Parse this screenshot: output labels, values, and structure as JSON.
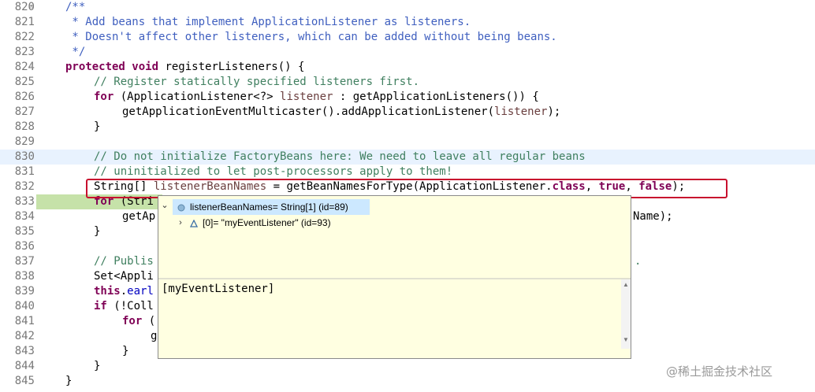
{
  "editor": {
    "lines": [
      {
        "num": "820",
        "fold": true
      },
      {
        "num": "821"
      },
      {
        "num": "822"
      },
      {
        "num": "823"
      },
      {
        "num": "824",
        "fold": true
      },
      {
        "num": "825"
      },
      {
        "num": "826"
      },
      {
        "num": "827"
      },
      {
        "num": "828"
      },
      {
        "num": "829"
      },
      {
        "num": "830"
      },
      {
        "num": "831"
      },
      {
        "num": "832"
      },
      {
        "num": "833"
      },
      {
        "num": "834"
      },
      {
        "num": "835"
      },
      {
        "num": "836"
      },
      {
        "num": "837"
      },
      {
        "num": "838"
      },
      {
        "num": "839"
      },
      {
        "num": "840"
      },
      {
        "num": "841"
      },
      {
        "num": "842"
      },
      {
        "num": "843"
      },
      {
        "num": "844"
      },
      {
        "num": "845"
      }
    ],
    "code": {
      "l820": "/**",
      "l821": " * Add beans that implement ApplicationListener as listeners.",
      "l822": " * Doesn't affect other listeners, which can be added without being beans.",
      "l823": " */",
      "l824_kw": "protected void",
      "l824_rest": " registerListeners() {",
      "l825": "// Register statically specified listeners first.",
      "l826_kw": "for",
      "l826_a": " (ApplicationListener<?> ",
      "l826_var": "listener",
      "l826_b": " : getApplicationListeners()) {",
      "l827_a": "getApplicationEventMulticaster().addApplicationListener(",
      "l827_var": "listener",
      "l827_b": ");",
      "l828": "}",
      "l830": "// Do not initialize FactoryBeans here: We need to leave all regular beans",
      "l831": "// uninitialized to let post-processors apply to them!",
      "l832_a": "String[] ",
      "l832_var": "listenerBeanNames",
      "l832_b": " = getBeanNamesForType(ApplicationListener.",
      "l832_kw1": "class",
      "l832_c": ", ",
      "l832_kw2": "true",
      "l832_d": ", ",
      "l832_kw3": "false",
      "l832_e": ");",
      "l833_kw": "for",
      "l833_a": " (Stri",
      "l834_a": "getAp",
      "l834_tail": "Name);",
      "l835": "}",
      "l837": "// Publis",
      "l837_tail": ".",
      "l838": "Set<Appli",
      "l839_kw": "this",
      "l839_a": ".",
      "l839_fld": "earl",
      "l840_kw": "if",
      "l840_a": " (!Coll",
      "l841_kw": "for",
      "l841_a": " (",
      "l842": "g",
      "l843": "}",
      "l844": "}",
      "l845": "}"
    }
  },
  "popup": {
    "root": {
      "label": "listenerBeanNames= String[1]  (id=89)",
      "expanded_glyph": "⌄"
    },
    "child": {
      "label": "[0]= \"myEventListener\" (id=93)",
      "collapsed_glyph": "›"
    },
    "detail_text": "[myEventListener]"
  },
  "watermark": "@稀土掘金技术社区",
  "colors": {
    "keyword": "#7f0055",
    "comment": "#3f7f5f",
    "javadoc": "#3f5fbf",
    "highlight": "#c8102e",
    "debug_line": "#c6e2a9"
  }
}
